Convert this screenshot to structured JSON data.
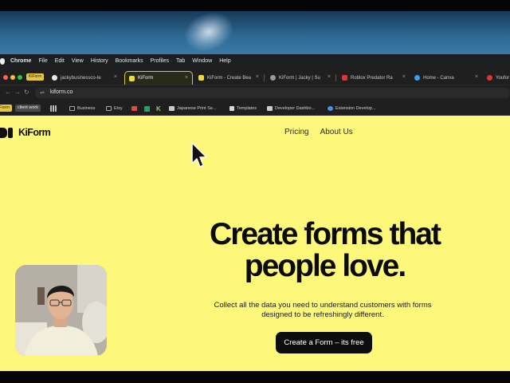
{
  "menubar": {
    "app": "Chrome",
    "items": [
      "File",
      "Edit",
      "View",
      "History",
      "Bookmarks",
      "Profiles",
      "Tab",
      "Window",
      "Help"
    ]
  },
  "tabs": {
    "profile_chip": "KiForm",
    "items": [
      {
        "title": "jackybusinessco-te",
        "icon": "github-icon",
        "color": "#e8e8e8"
      },
      {
        "title": "KiForm",
        "icon": "kiform-icon",
        "color": "#f0d93c"
      },
      {
        "title": "KiForm - Create Bea",
        "icon": "kiform-icon",
        "color": "#f0d93c"
      },
      {
        "title": "KiForm | Jacky | Su",
        "icon": "linear-icon",
        "color": "#9a9a9a"
      },
      {
        "title": "Roblox Predator Ra",
        "icon": "youtube-icon",
        "color": "#e3342f"
      },
      {
        "title": "Home - Canva",
        "icon": "canva-icon",
        "color": "#3aa0e8"
      },
      {
        "title": "Youfor",
        "icon": "pinterest-icon",
        "color": "#e3342f"
      }
    ]
  },
  "address": {
    "url": "kiform.co"
  },
  "bookmarks": {
    "chips": [
      "Form",
      "client work"
    ],
    "items": [
      {
        "label": "Business",
        "icon": "folder-icon",
        "color": "#a8a8a8"
      },
      {
        "label": "Etsy",
        "icon": "folder-icon",
        "color": "#a8a8a8"
      },
      {
        "label": "",
        "icon": "gmail-icon",
        "color": "#e8453c"
      },
      {
        "label": "",
        "icon": "sheets-icon",
        "color": "#21a366"
      },
      {
        "label": "",
        "icon": "k-icon",
        "color": "#7ed957"
      },
      {
        "label": "Japanese Print Se...",
        "icon": "image-icon",
        "color": "#c9c9c9"
      },
      {
        "label": "Templates",
        "icon": "doc-icon",
        "color": "#d9d9d9"
      },
      {
        "label": "Developer Dashbo...",
        "icon": "image-icon",
        "color": "#c9c9c9"
      },
      {
        "label": "Extension Develop...",
        "icon": "globe-icon",
        "color": "#4a8ee8"
      }
    ]
  },
  "page": {
    "logo": "KiForm",
    "nav": [
      "Pricing",
      "About Us"
    ],
    "hero_title": "Create forms that people love.",
    "hero_subtitle": "Collect all the data you need to understand customers with forms designed to be refreshingly different.",
    "cta": "Create a Form – its free"
  },
  "colors": {
    "page_bg": "#fdf77a",
    "accent": "#0d0d0d",
    "active_tab_border": "#d6c84a"
  }
}
